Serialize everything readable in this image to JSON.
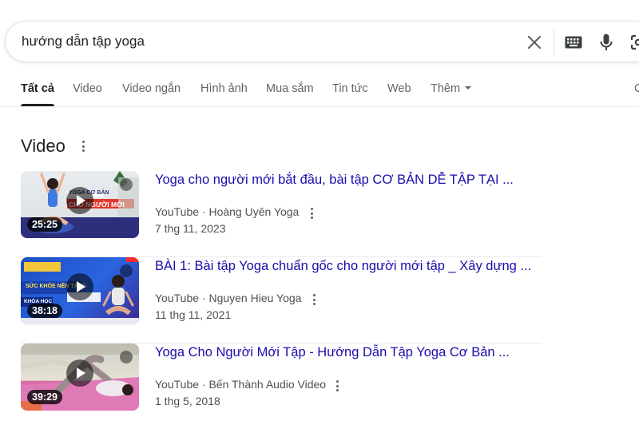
{
  "search": {
    "query": "hướng dẫn tập yoga"
  },
  "tabs": [
    {
      "label": "Tất cả",
      "active": true
    },
    {
      "label": "Video"
    },
    {
      "label": "Video ngắn"
    },
    {
      "label": "Hình ảnh"
    },
    {
      "label": "Mua sắm"
    },
    {
      "label": "Tin tức"
    },
    {
      "label": "Web"
    },
    {
      "label": "Thêm"
    }
  ],
  "tabs_right_partial": "C",
  "section": {
    "title": "Video"
  },
  "videos": [
    {
      "title": "Yoga cho người mới bắt đầu, bài tập CƠ BẢN DỄ TẬP TẠI ...",
      "source": "YouTube",
      "channel": "Hoàng Uyên Yoga",
      "meta": "YouTube · Hoàng Uyên Yoga",
      "date": "7 thg 11, 2023",
      "duration": "25:25",
      "thumb_text_1": "YOGA CƠ BẢN",
      "thumb_text_2": "CHO NGƯỜI MỚI"
    },
    {
      "title": "BÀI 1: Bài tập Yoga chuẩn gốc cho người mới tập _ Xây dựng ...",
      "source": "YouTube",
      "channel": "Nguyen Hieu Yoga",
      "meta": "YouTube · Nguyen Hieu Yoga",
      "date": "11 thg 11, 2021",
      "duration": "38:18",
      "thumb_text_1": "SỨC KHỎE NỀN TẢNG",
      "thumb_text_2": "KHÓA HỌC"
    },
    {
      "title": "Yoga Cho Người Mới Tập - Hướng Dẫn Tập Yoga Cơ Bản ...",
      "source": "YouTube",
      "channel": "Bến Thành Audio Video",
      "meta": "YouTube · Bến Thành Audio Video",
      "date": "1 thg 5, 2018",
      "duration": "39:29"
    }
  ],
  "colors": {
    "link": "#1a0dab",
    "meta": "#4d5156",
    "tab_inactive": "#5f6368",
    "tab_active": "#202124"
  },
  "icons": [
    "close-icon",
    "keyboard-icon",
    "mic-icon",
    "lens-icon",
    "more-vert-icon",
    "play-icon",
    "expand-icon",
    "caret-down-icon"
  ]
}
